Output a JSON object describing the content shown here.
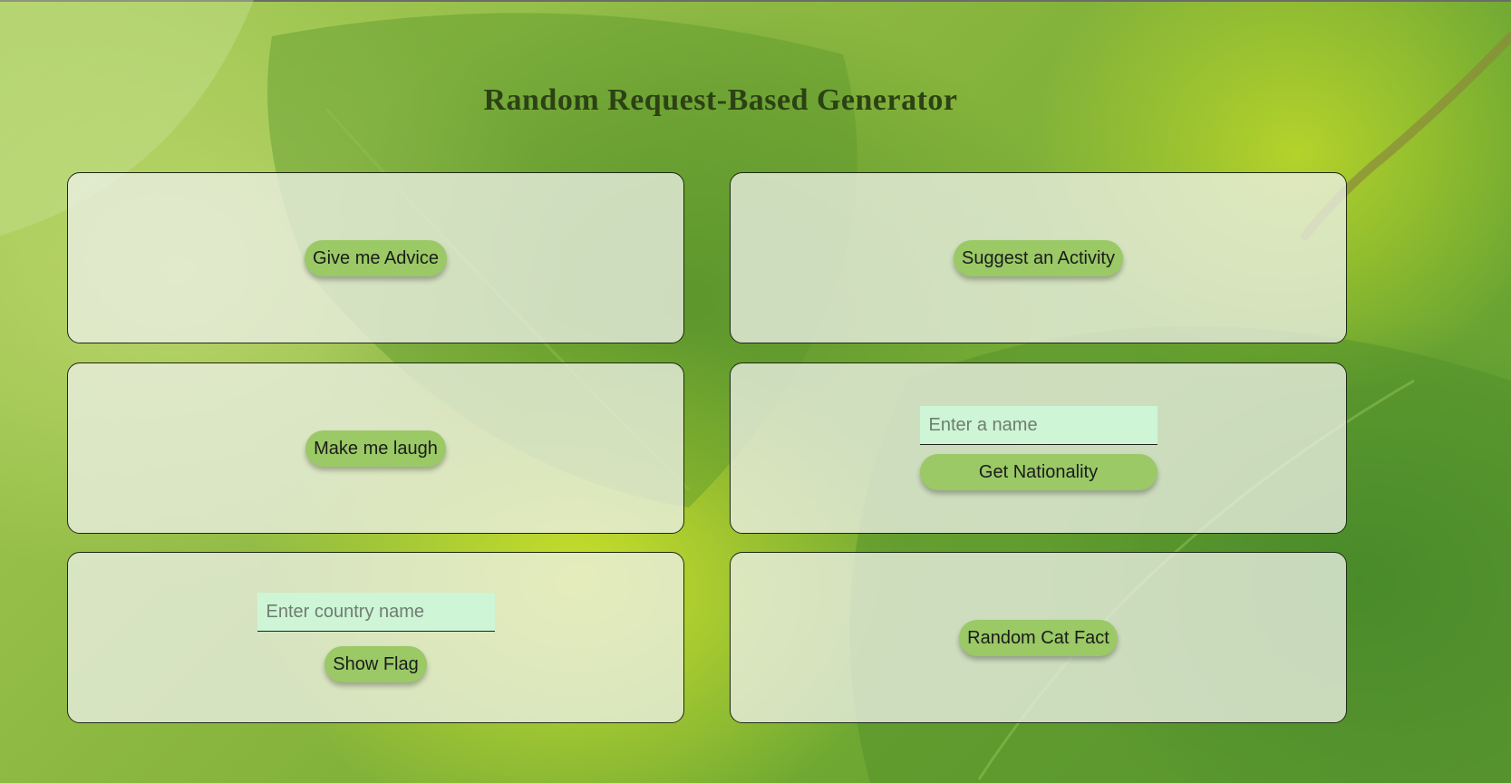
{
  "page": {
    "title": "Random Request-Based Generator"
  },
  "cards": {
    "advice": {
      "button_label": "Give me Advice"
    },
    "activity": {
      "button_label": "Suggest an Activity"
    },
    "joke": {
      "button_label": "Make me laugh"
    },
    "nationality": {
      "input_value": "",
      "input_placeholder": "Enter a name",
      "button_label": "Get Nationality"
    },
    "flag": {
      "input_value": "",
      "input_placeholder": "Enter country name",
      "button_label": "Show Flag"
    },
    "catfact": {
      "button_label": "Random Cat Fact"
    }
  },
  "colors": {
    "button_bg": "#9ac966",
    "input_bg": "#cdf5d6",
    "title_text": "#2c4214",
    "card_bg": "#ecf0e6"
  }
}
